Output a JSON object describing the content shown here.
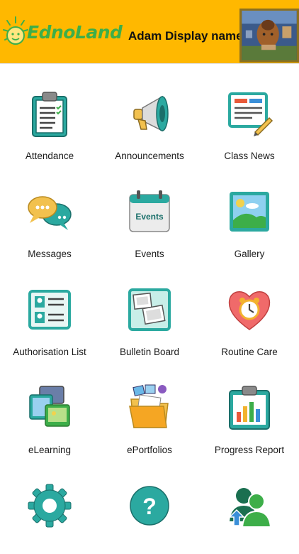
{
  "header": {
    "logo_text": "EdnoLand",
    "display_name": "Adam Display name",
    "background_color": "#FFB800",
    "logo_icon": "sun-face-logo-icon",
    "avatar_image": "child-drawing-avatar"
  },
  "menu": [
    {
      "label": "Attendance",
      "icon": "clipboard-checklist-icon"
    },
    {
      "label": "Announcements",
      "icon": "megaphone-icon"
    },
    {
      "label": "Class News",
      "icon": "newspaper-pencil-icon"
    },
    {
      "label": "Messages",
      "icon": "chat-bubbles-icon"
    },
    {
      "label": "Events",
      "icon": "events-calendar-icon",
      "icon_text": "Events"
    },
    {
      "label": "Gallery",
      "icon": "landscape-picture-icon"
    },
    {
      "label": "Authorisation List",
      "icon": "id-card-list-icon"
    },
    {
      "label": "Bulletin Board",
      "icon": "pinned-photos-icon"
    },
    {
      "label": "Routine Care",
      "icon": "heart-alarm-clock-icon"
    },
    {
      "label": "eLearning",
      "icon": "devices-icon"
    },
    {
      "label": "ePortfolios",
      "icon": "folder-documents-icon"
    },
    {
      "label": "Progress Report",
      "icon": "clipboard-bar-chart-icon"
    },
    {
      "label": "",
      "icon": "gear-icon"
    },
    {
      "label": "",
      "icon": "help-question-icon"
    },
    {
      "label": "",
      "icon": "users-icon"
    }
  ]
}
